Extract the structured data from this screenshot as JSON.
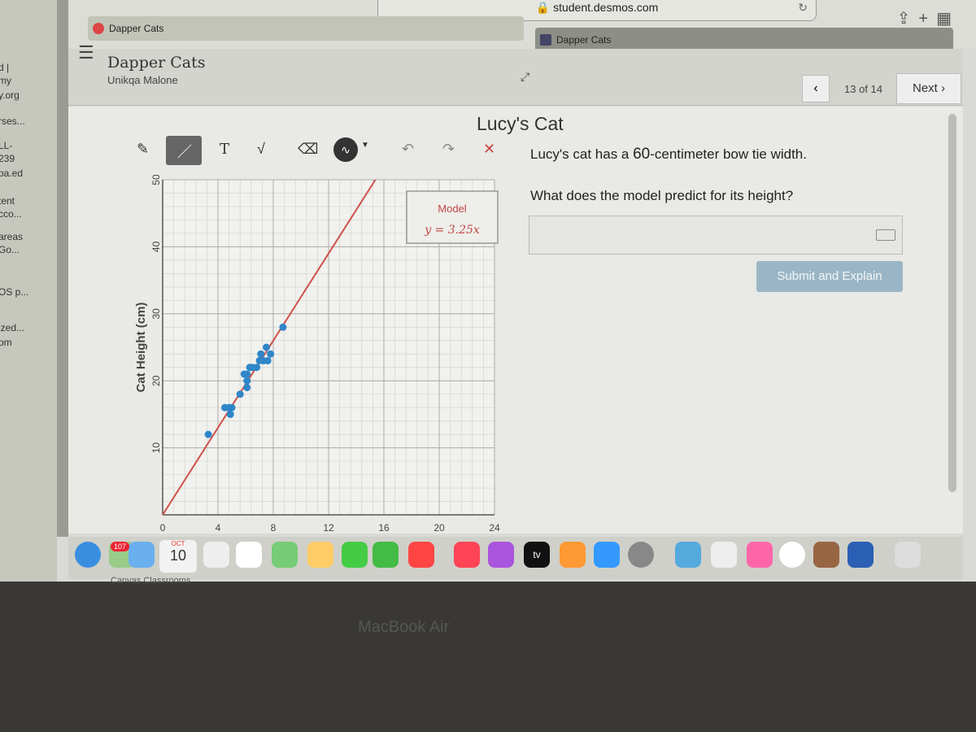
{
  "browser": {
    "url": "student.desmos.com",
    "tabs": [
      {
        "label": "Dapper Cats"
      },
      {
        "label": "Dapper Cats"
      }
    ]
  },
  "left_pane": {
    "fragments": [
      "d |",
      "my",
      "y.org",
      "rses...",
      "LL-",
      "239",
      "pa.ed",
      "tent",
      "cco...",
      "areas",
      "Go...",
      "OS p...",
      "ized...",
      "om"
    ]
  },
  "header": {
    "activity_title": "Dapper Cats",
    "student_name": "Unikqa Malone",
    "page_indicator": "13 of 14",
    "next_label": "Next",
    "prev_icon": "chevron-left-icon"
  },
  "screen": {
    "title": "Lucy's Cat",
    "prompt_parts": [
      "Lucy's cat has a ",
      "60",
      "-centimeter bow tie width."
    ],
    "question": "What does the model predict for its height?",
    "answer_value": "",
    "submit_label": "Submit and Explain"
  },
  "toolbar": {
    "tools": [
      "pencil",
      "line",
      "text",
      "math",
      "eraser",
      "color",
      "undo",
      "redo",
      "clear"
    ],
    "text_tool": "T",
    "math_tool": "√"
  },
  "chart_data": {
    "type": "scatter",
    "ylabel": "Cat Height (cm)",
    "xlabel": "",
    "xlim": [
      0,
      24
    ],
    "ylim": [
      0,
      50
    ],
    "xticks": [
      "0",
      "4",
      "8",
      "12",
      "16",
      "20",
      "24"
    ],
    "yticks": [
      "10",
      "20",
      "30",
      "40",
      "50"
    ],
    "grid": true,
    "points_color": "#2e86c8",
    "line_color": "#d0504a",
    "points": [
      [
        3.3,
        12
      ],
      [
        4.5,
        16
      ],
      [
        4.8,
        16
      ],
      [
        4.9,
        15
      ],
      [
        5.0,
        16
      ],
      [
        5.6,
        18
      ],
      [
        5.9,
        21
      ],
      [
        6.1,
        21
      ],
      [
        6.1,
        20
      ],
      [
        6.1,
        19
      ],
      [
        6.3,
        22
      ],
      [
        6.5,
        22
      ],
      [
        6.8,
        22
      ],
      [
        7.0,
        23
      ],
      [
        7.1,
        24
      ],
      [
        7.3,
        23
      ],
      [
        7.5,
        25
      ],
      [
        7.6,
        23
      ],
      [
        7.8,
        24
      ],
      [
        8.7,
        28
      ]
    ],
    "model": {
      "label": "Model",
      "equation": "y = 3.25x",
      "slope": 3.25
    },
    "legend_placement": "top-right"
  },
  "dock": {
    "calendar_month": "OCT",
    "calendar_day": "10",
    "mail_badge": "107",
    "caption": "Canvas Classrooms",
    "tv_label": "tv"
  },
  "device_label": "MacBook Air"
}
